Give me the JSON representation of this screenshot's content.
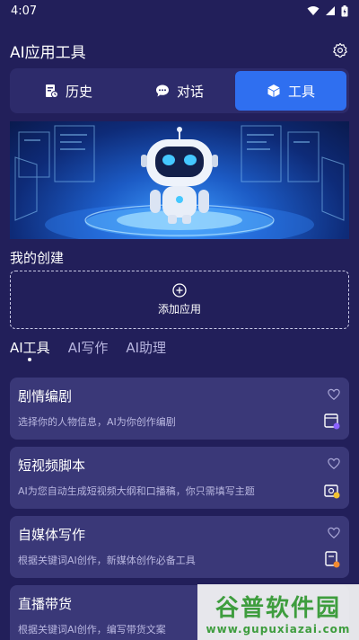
{
  "status_bar": {
    "time": "4:07"
  },
  "header": {
    "title": "AI应用工具"
  },
  "segments": [
    {
      "label": "历史"
    },
    {
      "label": "对话"
    },
    {
      "label": "工具"
    }
  ],
  "create": {
    "title": "我的创建",
    "add_label": "添加应用"
  },
  "tabs": [
    {
      "label": "AI工具"
    },
    {
      "label": "AI写作"
    },
    {
      "label": "AI助理"
    }
  ],
  "cards": [
    {
      "title": "剧情编剧",
      "desc": "选择你的人物信息，AI为你创作编剧"
    },
    {
      "title": "短视频脚本",
      "desc": "AI为您自动生成短视频大纲和口播稿，你只需填写主题"
    },
    {
      "title": "自媒体写作",
      "desc": "根据关键词AI创作，新媒体创作必备工具"
    },
    {
      "title": "直播带货",
      "desc": "根据关键词AI创作，编写带货文案"
    }
  ],
  "watermark": {
    "title": "谷普软件园",
    "url": "www.gupuxiazai.com"
  },
  "colors": {
    "background": "#221f5a",
    "accent": "#2f6ff0",
    "card": "#3a3878"
  }
}
